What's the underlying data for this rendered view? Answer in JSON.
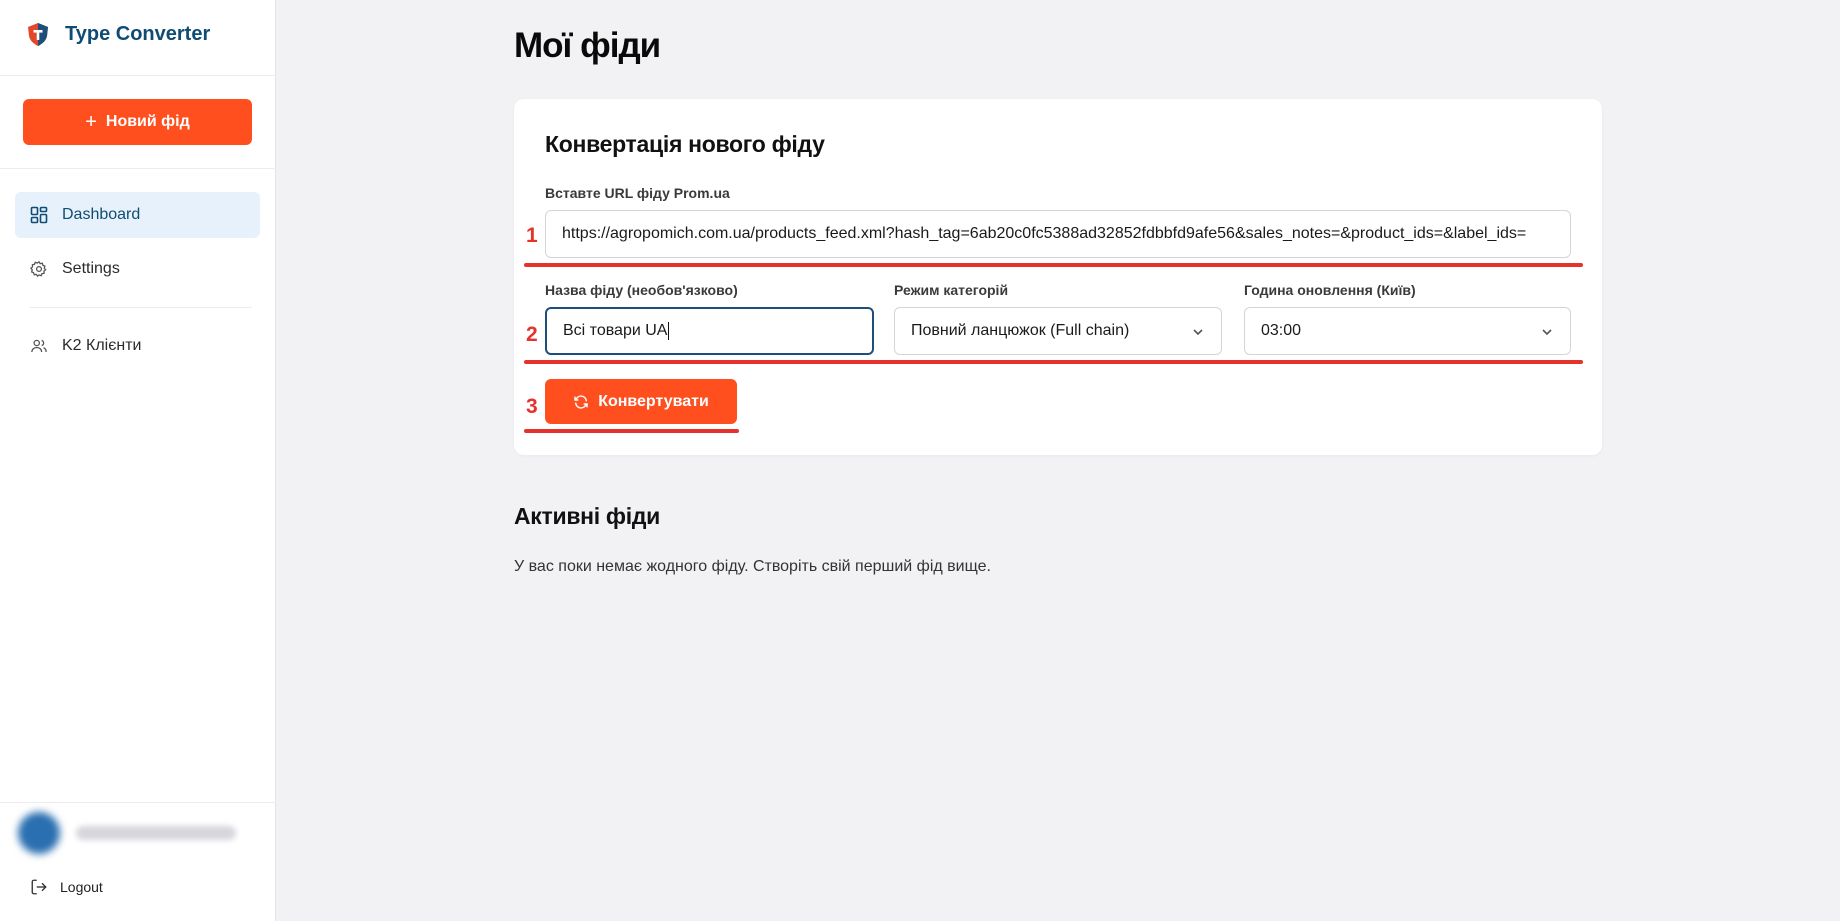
{
  "app": {
    "name": "Type Converter"
  },
  "sidebar": {
    "new_feed_label": "Новий фід",
    "items": [
      {
        "label": "Dashboard",
        "icon": "dashboard-icon",
        "active": true
      },
      {
        "label": "Settings",
        "icon": "gear-icon",
        "active": false
      },
      {
        "label": "K2 Клієнти",
        "icon": "users-icon",
        "active": false
      }
    ],
    "logout_label": "Logout"
  },
  "main": {
    "page_title": "Мої фіди",
    "converter": {
      "title": "Конвертація нового фіду",
      "url_label": "Вставте URL фіду Prom.ua",
      "url_value": "https://agropomich.com.ua/products_feed.xml?hash_tag=6ab20c0fc5388ad32852fdbbfd9afe56&sales_notes=&product_ids=&label_ids=",
      "name_label": "Назва фіду (необов'язково)",
      "name_value": "Всі товари UA",
      "mode_label": "Режим категорій",
      "mode_value": "Повний ланцюжок (Full chain)",
      "time_label": "Година оновлення (Київ)",
      "time_value": "03:00",
      "convert_label": "Конвертувати"
    },
    "active": {
      "title": "Активні фіди",
      "empty_text": "У вас поки немає жодного фіду. Створіть свій перший фід вище."
    }
  },
  "annotations": [
    "1",
    "2",
    "3"
  ],
  "colors": {
    "accent": "#ff4f1f",
    "brand": "#0f4c73",
    "annotation": "#e5322b",
    "active_bg": "#e7f1fb"
  }
}
